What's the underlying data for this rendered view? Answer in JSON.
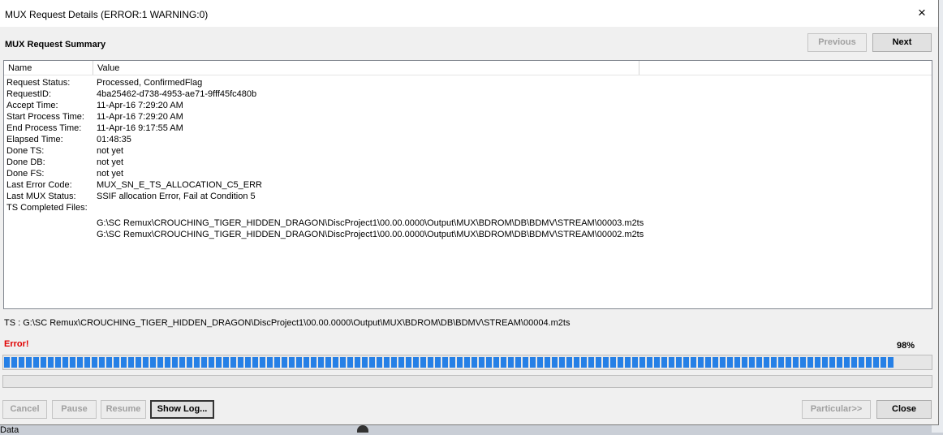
{
  "window": {
    "title": "MUX Request Details  (ERROR:1 WARNING:0)",
    "close_icon": "×"
  },
  "summary": {
    "heading": "MUX Request Summary"
  },
  "nav": {
    "previous": "Previous",
    "next": "Next"
  },
  "table": {
    "columns": [
      "Name",
      "Value"
    ],
    "rows": [
      {
        "name": "Request Status:",
        "value": "Processed, ConfirmedFlag"
      },
      {
        "name": "RequestID:",
        "value": "4ba25462-d738-4953-ae71-9fff45fc480b"
      },
      {
        "name": "Accept Time:",
        "value": " 11-Apr-16 7:29:20 AM"
      },
      {
        "name": "Start Process Time:",
        "value": " 11-Apr-16 7:29:20 AM"
      },
      {
        "name": "End Process Time:",
        "value": " 11-Apr-16 9:17:55 AM"
      },
      {
        "name": "Elapsed Time:",
        "value": "01:48:35"
      },
      {
        "name": "Done TS:",
        "value": "not yet"
      },
      {
        "name": "Done DB:",
        "value": "not yet"
      },
      {
        "name": "Done FS:",
        "value": "not yet"
      },
      {
        "name": "Last Error Code:",
        "value": "MUX_SN_E_TS_ALLOCATION_C5_ERR"
      },
      {
        "name": "Last MUX Status:",
        "value": " SSIF allocation Error, Fail at Condition 5"
      },
      {
        "name": "TS Completed Files:",
        "value": ""
      },
      {
        "name": "",
        "value": "G:\\SC Remux\\CROUCHING_TIGER_HIDDEN_DRAGON\\DiscProject1\\00.00.0000\\Output\\MUX\\BDROM\\DB\\BDMV\\STREAM\\00003.m2ts"
      },
      {
        "name": "",
        "value": "G:\\SC Remux\\CROUCHING_TIGER_HIDDEN_DRAGON\\DiscProject1\\00.00.0000\\Output\\MUX\\BDROM\\DB\\BDMV\\STREAM\\00002.m2ts"
      }
    ]
  },
  "status": {
    "ts_line": "TS : G:\\SC Remux\\CROUCHING_TIGER_HIDDEN_DRAGON\\DiscProject1\\00.00.0000\\Output\\MUX\\BDROM\\DB\\BDMV\\STREAM\\00004.m2ts",
    "error": "Error!",
    "percent_label": "98%",
    "progress": 98
  },
  "buttons": {
    "cancel": "Cancel",
    "pause": "Pause",
    "resume": "Resume",
    "show_log": "Show Log...",
    "particular": "Particular>>",
    "close": "Close"
  },
  "background": {
    "bottom_text": "Data"
  },
  "colors": {
    "error": "#e00000",
    "progress": "#2680e6"
  }
}
